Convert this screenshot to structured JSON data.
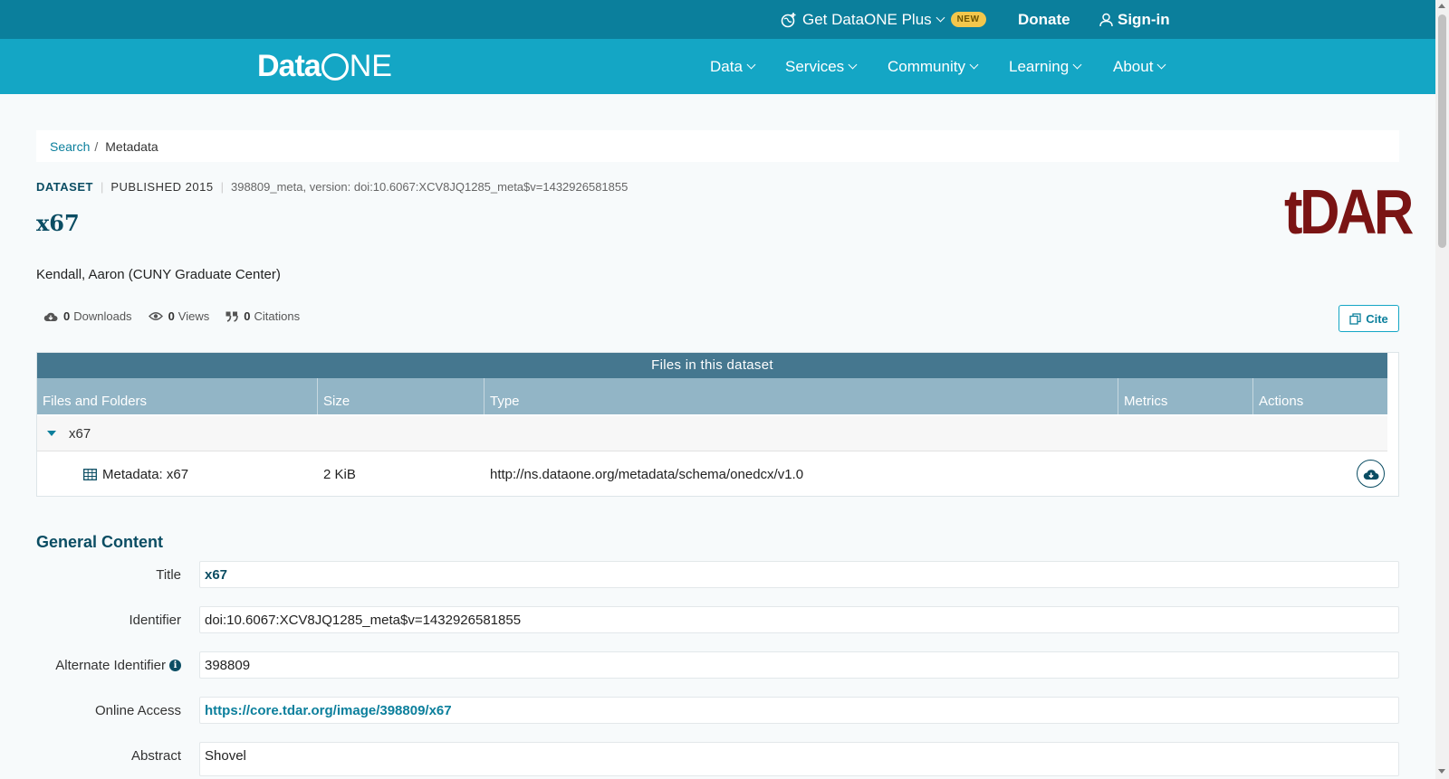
{
  "topbar": {
    "plus_label": "Get DataONE Plus",
    "new_badge": "NEW",
    "donate": "Donate",
    "signin": "Sign-in"
  },
  "navbar": {
    "logo_data": "Data",
    "logo_one": "NE",
    "items": [
      "Data",
      "Services",
      "Community",
      "Learning",
      "About"
    ]
  },
  "breadcrumb": {
    "search": "Search",
    "sep": "/",
    "current": "Metadata"
  },
  "dataset": {
    "kind": "DATASET",
    "published": "PUBLISHED 2015",
    "version": "398809_meta, version: doi:10.6067:XCV8JQ1285_meta$v=1432926581855",
    "title": "x67",
    "author": "Kendall, Aaron (CUNY Graduate Center)",
    "repo_logo": "tDAR",
    "metrics": {
      "downloads": "0",
      "downloads_label": "Downloads",
      "views": "0",
      "views_label": "Views",
      "citations": "0",
      "citations_label": "Citations"
    },
    "cite_label": "Cite"
  },
  "files": {
    "heading": "Files in this dataset",
    "columns": [
      "Files and Folders",
      "Size",
      "Type",
      "Metrics",
      "Actions"
    ],
    "folder": "x67",
    "rows": [
      {
        "name": "Metadata: x67",
        "size": "2 KiB",
        "type": "http://ns.dataone.org/metadata/schema/onedcx/v1.0"
      }
    ]
  },
  "general": {
    "heading": "General Content",
    "fields": [
      {
        "label": "Title",
        "value": "x67"
      },
      {
        "label": "Identifier",
        "value": "doi:10.6067:XCV8JQ1285_meta$v=1432926581855"
      },
      {
        "label": "Alternate Identifier",
        "value": "398809"
      },
      {
        "label": "Online Access",
        "value": "https://core.tdar.org/image/398809/x67"
      },
      {
        "label": "Abstract",
        "value": "Shovel"
      }
    ]
  },
  "colors": {
    "topbar": "#0b7f9c",
    "navbar": "#14a6c5",
    "files_header": "#45778f",
    "col_header": "#92b5c6",
    "title": "#0b4d63",
    "tdar": "#7a1414"
  }
}
